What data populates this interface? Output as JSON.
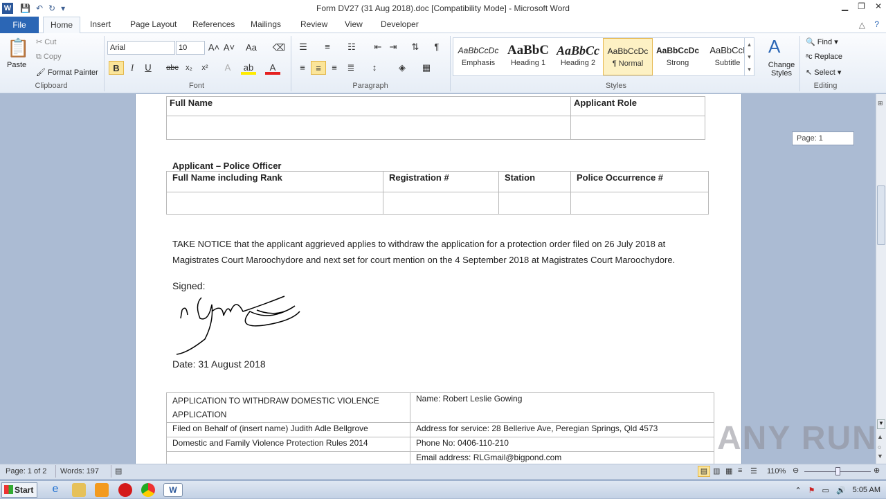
{
  "title_bar": {
    "title": "Form DV27 (31 Aug 2018).doc [Compatibility Mode] - Microsoft Word",
    "app_icon": "W"
  },
  "tabs": [
    "File",
    "Home",
    "Insert",
    "Page Layout",
    "References",
    "Mailings",
    "Review",
    "View",
    "Developer"
  ],
  "clipboard": {
    "paste": "Paste",
    "cut": "Cut",
    "copy": "Copy",
    "format_painter": "Format Painter",
    "label": "Clipboard"
  },
  "font": {
    "name": "Arial",
    "size": "10",
    "label": "Font"
  },
  "paragraph": {
    "label": "Paragraph"
  },
  "styles": {
    "items": [
      {
        "preview": "AaBbCcDc",
        "label": "Emphasis"
      },
      {
        "preview": "AaBbC",
        "label": "Heading 1"
      },
      {
        "preview": "AaBbCc",
        "label": "Heading 2"
      },
      {
        "preview": "AaBbCcDc",
        "label": "¶ Normal"
      },
      {
        "preview": "AaBbCcDc",
        "label": "Strong"
      },
      {
        "preview": "AaBbCcI",
        "label": "Subtitle"
      }
    ],
    "change_styles": "Change Styles",
    "label": "Styles"
  },
  "editing": {
    "find": "Find",
    "replace": "Replace",
    "select": "Select",
    "label": "Editing"
  },
  "page_tip": "Page: 1",
  "doc": {
    "t1_headers": [
      "Full Name",
      "Applicant Role"
    ],
    "section2_title": "Applicant – Police Officer",
    "t2_headers": [
      "Full Name including Rank",
      "Registration #",
      "Station",
      "Police Occurrence #"
    ],
    "notice_line1": "TAKE NOTICE  that the applicant aggrieved  applies to withdraw the application for a protection order filed on 26 July 2018 at",
    "notice_line2": "Magistrates Court Maroochydore  and next set for court mention on the 4 September 2018 at Magistrates Court Maroochydore.",
    "signed": "Signed:",
    "date": "Date:  31 August 2018",
    "footer_rows": [
      [
        "APPLICATION TO WITHDRAW DOMESTIC VIOLENCE APPLICATION",
        "Name: Robert Leslie Gowing"
      ],
      [
        "Filed on Behalf of (insert name) Judith Adle Bellgrove",
        "Address for service:  28 Bellerive Ave, Peregian Springs, Qld 4573"
      ],
      [
        "Domestic and Family Violence Protection Rules 2014",
        "Phone No: 0406-110-210"
      ],
      [
        "",
        "Email address:  RLGmail@bigpond.com"
      ]
    ]
  },
  "status": {
    "page": "Page: 1 of 2",
    "words": "Words: 197",
    "zoom": "110%"
  },
  "taskbar": {
    "start": "Start",
    "time": "5:05 AM"
  },
  "watermark": "ANY RUN"
}
